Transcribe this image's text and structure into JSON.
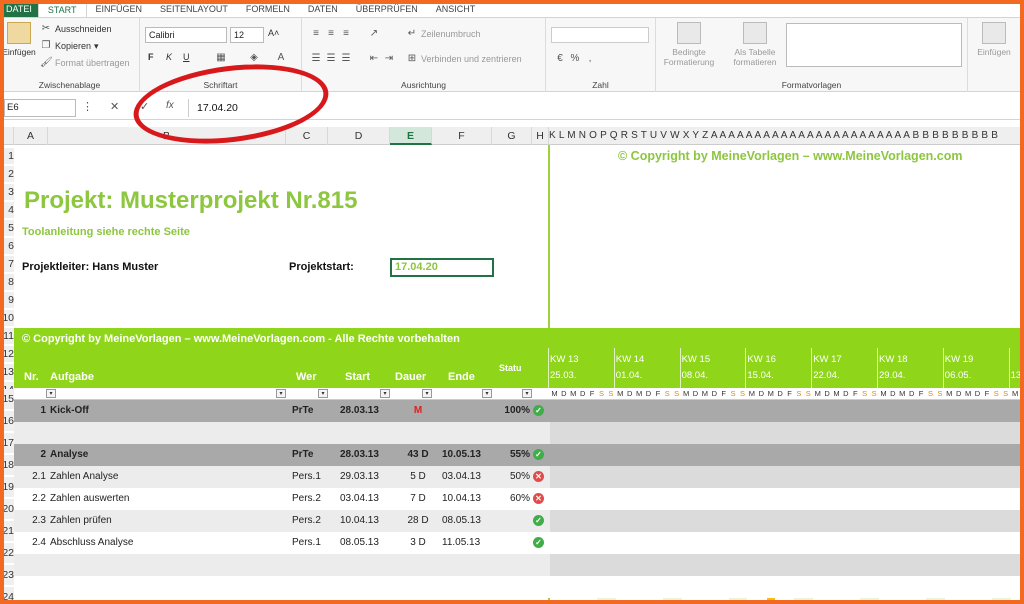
{
  "tabs": [
    "DATEI",
    "START",
    "EINFÜGEN",
    "SEITENLAYOUT",
    "FORMELN",
    "DATEN",
    "ÜBERPRÜFEN",
    "ANSICHT"
  ],
  "ribbon": {
    "paste_label": "Einfügen",
    "cut": "Ausschneiden",
    "copy": "Kopieren",
    "format_painter": "Format übertragen",
    "clipboard_group": "Zwischenablage",
    "font_name": "Calibri",
    "font_size": "12",
    "bold": "F",
    "italic": "K",
    "underline": "U",
    "font_group": "Schriftart",
    "wrap_text": "Zeilenumbruch",
    "merge_center": "Verbinden und zentrieren",
    "alignment_group": "Ausrichtung",
    "number_group": "Zahl",
    "conditional_formatting": "Bedingte Formatierung",
    "as_table": "Als Tabelle formatieren",
    "styles_group": "Formatvorlagen",
    "insert_cells": "Einfügen"
  },
  "formula_bar": {
    "name_box": "E6",
    "cancel": "✕",
    "confirm": "✓",
    "fx": "fx",
    "value": "17.04.20"
  },
  "columns": [
    "A",
    "B",
    "C",
    "D",
    "E",
    "F",
    "G",
    "H"
  ],
  "gantt_columns": "K L M N O P Q R S T U V W X Y Z A A A A A A A A A A A A A A A A A A A A A A A B B B B B B B B B",
  "rows": [
    "1",
    "2",
    "3",
    "4",
    "5",
    "6",
    "7",
    "8",
    "9",
    "10",
    "11",
    "12",
    "13",
    "14",
    "15",
    "16",
    "17",
    "18",
    "19",
    "20",
    "21",
    "22",
    "23",
    "24"
  ],
  "sheet": {
    "copyright_top": "© Copyright by MeineVorlagen – www.MeineVorlagen.com",
    "title": "Projekt: Musterprojekt Nr.815",
    "subtitle": "Toolanleitung siehe rechte Seite",
    "project_lead": "Projektleiter: Hans Muster",
    "project_start_label": "Projektstart:",
    "project_start_value": "17.04.20",
    "copyright_bar": "© Copyright by MeineVorlagen – www.MeineVorlagen.com - Alle Rechte vorbehalten",
    "headers": {
      "nr": "Nr.",
      "task": "Aufgabe",
      "who": "Wer",
      "start": "Start",
      "duration": "Dauer",
      "end": "Ende",
      "status": "Statu"
    }
  },
  "weeks": [
    {
      "kw": "KW 13",
      "date": "25.03."
    },
    {
      "kw": "KW 14",
      "date": "01.04."
    },
    {
      "kw": "KW 15",
      "date": "08.04."
    },
    {
      "kw": "KW 16",
      "date": "15.04."
    },
    {
      "kw": "KW 17",
      "date": "22.04."
    },
    {
      "kw": "KW 18",
      "date": "29.04."
    },
    {
      "kw": "KW 19",
      "date": "06.05."
    },
    {
      "kw": "",
      "date": "13"
    }
  ],
  "day_letters": [
    "M",
    "D",
    "M",
    "D",
    "F",
    "S",
    "S"
  ],
  "tasks": [
    {
      "nr": "1",
      "name": "Kick-Off",
      "who": "PrTe",
      "start": "28.03.13",
      "duration": "M",
      "end": "",
      "status": "100%",
      "icon": "ok",
      "summary": true
    },
    {
      "nr": "",
      "name": "",
      "who": "",
      "start": "",
      "duration": "",
      "end": "",
      "status": "",
      "icon": "",
      "summary": false
    },
    {
      "nr": "2",
      "name": "Analyse",
      "who": "PrTe",
      "start": "28.03.13",
      "duration": "43 D",
      "end": "10.05.13",
      "status": "55%",
      "icon": "ok",
      "summary": true
    },
    {
      "nr": "2.1",
      "name": "Zahlen Analyse",
      "who": "Pers.1",
      "start": "29.03.13",
      "duration": "5 D",
      "end": "03.04.13",
      "status": "50%",
      "icon": "bad",
      "summary": false
    },
    {
      "nr": "2.2",
      "name": "Zahlen auswerten",
      "who": "Pers.2",
      "start": "03.04.13",
      "duration": "7 D",
      "end": "10.04.13",
      "status": "60%",
      "icon": "bad",
      "summary": false
    },
    {
      "nr": "2.3",
      "name": "Zahlen prüfen",
      "who": "Pers.2",
      "start": "10.04.13",
      "duration": "28 D",
      "end": "08.05.13",
      "status": "",
      "icon": "ok",
      "summary": false
    },
    {
      "nr": "2.4",
      "name": "Abschluss Analyse",
      "who": "Pers.1",
      "start": "08.05.13",
      "duration": "3 D",
      "end": "11.05.13",
      "status": "",
      "icon": "ok",
      "summary": false
    }
  ],
  "colors": {
    "accent": "#8dc63f",
    "bar": "#8fd61a",
    "excel_green": "#217346",
    "red": "#ff0000",
    "today": "#f5b800",
    "dark": "#2f3a2f"
  }
}
